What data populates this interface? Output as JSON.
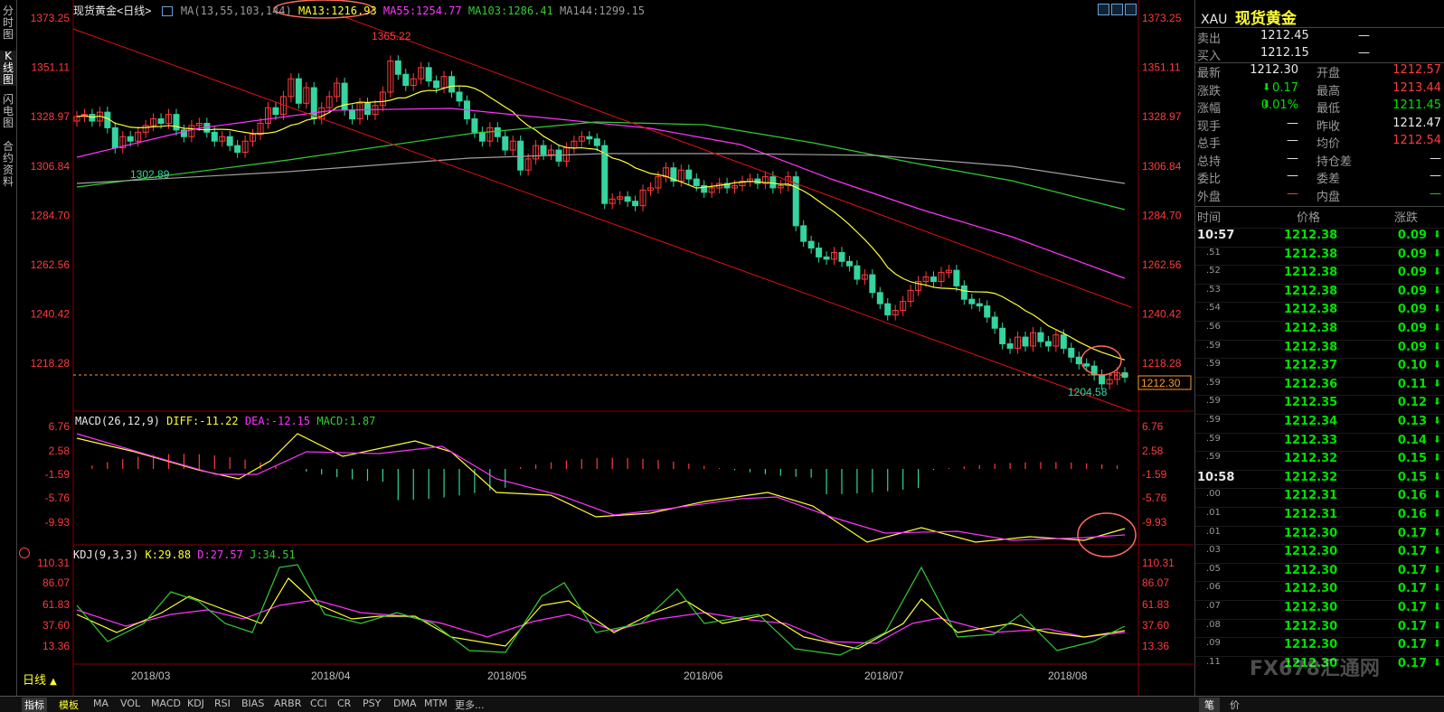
{
  "left_tabs": [
    "分时图",
    "K线图",
    "闪电图",
    "合约资料"
  ],
  "header": {
    "title": "现货黄金<日线>",
    "ma_label": "MA(13,55,103,144)",
    "ma13": "MA13:1216.93",
    "ma55": "MA55:1254.77",
    "ma103": "MA103:1286.41",
    "ma144": "MA144:1299.15"
  },
  "macd_header": {
    "label": "MACD(26,12,9)",
    "diff": "DIFF:-11.22",
    "dea": "DEA:-12.15",
    "macd": "MACD:1.87"
  },
  "kdj_header": {
    "label": "KDJ(9,3,3)",
    "k": "K:29.88",
    "d": "D:27.57",
    "j": "J:34.51"
  },
  "price_axis": [
    "1373.25",
    "1351.11",
    "1328.97",
    "1306.84",
    "1284.70",
    "1262.56",
    "1240.42",
    "1218.28"
  ],
  "macd_axis": [
    "6.76",
    "2.58",
    "-1.59",
    "-5.76",
    "-9.93"
  ],
  "kdj_axis": [
    "110.31",
    "86.07",
    "61.83",
    "37.60",
    "13.36"
  ],
  "annotations": {
    "high": "1365.22",
    "low1": "1302.89",
    "low2": "1204.58",
    "current": "1212.30"
  },
  "date_axis": [
    "2018/03",
    "2018/04",
    "2018/05",
    "2018/06",
    "2018/07",
    "2018/08"
  ],
  "period_label": "日线",
  "bottom_tabs": [
    "指标",
    "模板",
    "MA",
    "VOL",
    "MACD",
    "KDJ",
    "RSI",
    "BIAS",
    "ARBR",
    "CCI",
    "CR",
    "PSY",
    "DMA",
    "MTM",
    "更多..."
  ],
  "right_panel": {
    "code": "XAU",
    "name": "现货黄金",
    "quote_rows": [
      {
        "label": "卖出",
        "value": "1212.45",
        "extra": "—"
      },
      {
        "label": "买入",
        "value": "1212.15",
        "extra": "—"
      }
    ],
    "stats": [
      {
        "l1": "最新",
        "v1": "1212.30",
        "l2": "开盘",
        "v2": "1212.57"
      },
      {
        "l1": "涨跌",
        "v1": "0.17",
        "l2": "最高",
        "v2": "1213.44"
      },
      {
        "l1": "涨幅",
        "v1": "0.01%",
        "l2": "最低",
        "v2": "1211.45"
      },
      {
        "l1": "现手",
        "v1": "—",
        "l2": "昨收",
        "v2": "1212.47"
      },
      {
        "l1": "总手",
        "v1": "—",
        "l2": "均价",
        "v2": "1212.54"
      },
      {
        "l1": "总持",
        "v1": "—",
        "l2": "持仓差",
        "v2": "—"
      },
      {
        "l1": "委比",
        "v1": "—",
        "l2": "委差",
        "v2": "—"
      },
      {
        "l1": "外盘",
        "v1": "—",
        "l2": "内盘",
        "v2": "—"
      }
    ],
    "tick_headers": {
      "time": "时间",
      "price": "价格",
      "change": "涨跌"
    },
    "ticks": [
      {
        "t": "10:57",
        "p": "1212.38",
        "c": "0.09"
      },
      {
        "t": ".51",
        "p": "1212.38",
        "c": "0.09"
      },
      {
        "t": ".52",
        "p": "1212.38",
        "c": "0.09"
      },
      {
        "t": ".53",
        "p": "1212.38",
        "c": "0.09"
      },
      {
        "t": ".54",
        "p": "1212.38",
        "c": "0.09"
      },
      {
        "t": ".56",
        "p": "1212.38",
        "c": "0.09"
      },
      {
        "t": ".59",
        "p": "1212.38",
        "c": "0.09"
      },
      {
        "t": ".59",
        "p": "1212.37",
        "c": "0.10"
      },
      {
        "t": ".59",
        "p": "1212.36",
        "c": "0.11"
      },
      {
        "t": ".59",
        "p": "1212.35",
        "c": "0.12"
      },
      {
        "t": ".59",
        "p": "1212.34",
        "c": "0.13"
      },
      {
        "t": ".59",
        "p": "1212.33",
        "c": "0.14"
      },
      {
        "t": ".59",
        "p": "1212.32",
        "c": "0.15"
      },
      {
        "t": "10:58",
        "p": "1212.32",
        "c": "0.15"
      },
      {
        "t": ".00",
        "p": "1212.31",
        "c": "0.16"
      },
      {
        "t": ".01",
        "p": "1212.31",
        "c": "0.16"
      },
      {
        "t": ".01",
        "p": "1212.30",
        "c": "0.17"
      },
      {
        "t": ".03",
        "p": "1212.30",
        "c": "0.17"
      },
      {
        "t": ".05",
        "p": "1212.30",
        "c": "0.17"
      },
      {
        "t": ".06",
        "p": "1212.30",
        "c": "0.17"
      },
      {
        "t": ".07",
        "p": "1212.30",
        "c": "0.17"
      },
      {
        "t": ".08",
        "p": "1212.30",
        "c": "0.17"
      },
      {
        "t": ".09",
        "p": "1212.30",
        "c": "0.17"
      },
      {
        "t": ".11",
        "p": "1212.30",
        "c": "0.17"
      }
    ],
    "bottom_tabs": [
      "笔",
      "价"
    ],
    "watermark": "FX678汇通网"
  },
  "colors": {
    "up": "#ff3b3b",
    "down": "#35d4a0",
    "ma13": "#ffff33",
    "ma55": "#ff33ff",
    "ma103": "#33cc33",
    "ma144": "#a0a0a0",
    "channel": "#e01010",
    "circle": "#ff6b5b"
  }
}
